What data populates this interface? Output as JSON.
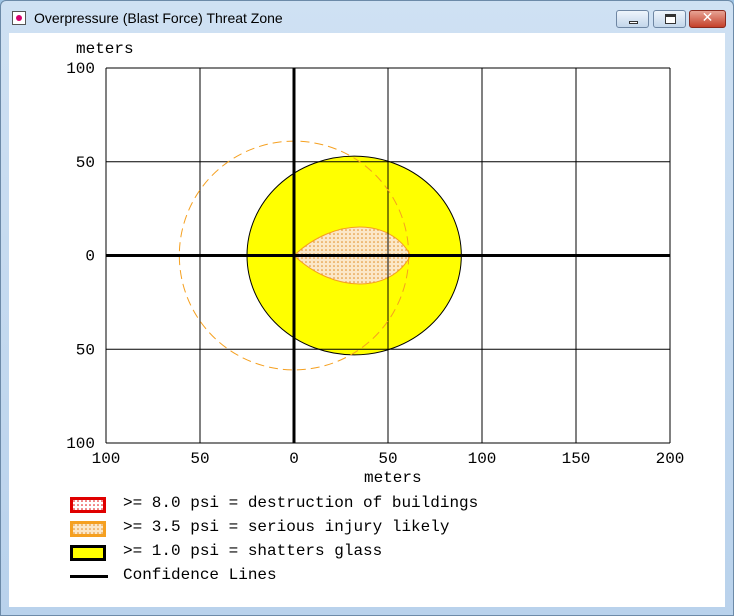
{
  "window": {
    "title": "Overpressure (Blast Force) Threat Zone",
    "colors": {
      "zone_8psi": "#e00000",
      "zone_3_5psi": "#f5a020",
      "zone_1psi": "#ffff00",
      "confidence": "#f5a020"
    }
  },
  "chart_data": {
    "type": "threat-zone-map",
    "y_unit_label": "meters",
    "x_unit_label": "meters",
    "xlim": [
      -100,
      200
    ],
    "ylim": [
      -100,
      100
    ],
    "x_ticks": [
      "100",
      "50",
      "0",
      "50",
      "100",
      "150",
      "200"
    ],
    "y_ticks": [
      "100",
      "50",
      "0",
      "50",
      "100"
    ],
    "grid": true,
    "zones": [
      {
        "name": ">= 1.0 psi",
        "shape": "ellipse",
        "center": [
          32,
          0
        ],
        "radius_x": 57,
        "radius_y": 53
      },
      {
        "name": ">= 3.5 psi",
        "shape": "teardrop",
        "tip": [
          0,
          0
        ],
        "end_x": 62,
        "half_width": 15
      },
      {
        "name": ">= 8.0 psi",
        "shape": "none"
      }
    ],
    "confidence_lines": {
      "shape": "circle-dashed",
      "center": [
        0,
        0
      ],
      "radius": 61
    }
  },
  "legend": {
    "items": [
      {
        "label": ">= 8.0 psi = destruction of buildings",
        "swatch": "red-dotted"
      },
      {
        "label": ">= 3.5 psi = serious injury likely",
        "swatch": "orange-dotted"
      },
      {
        "label": ">= 1.0 psi = shatters glass",
        "swatch": "yellow"
      },
      {
        "label": "Confidence Lines",
        "swatch": "black-line"
      }
    ]
  }
}
